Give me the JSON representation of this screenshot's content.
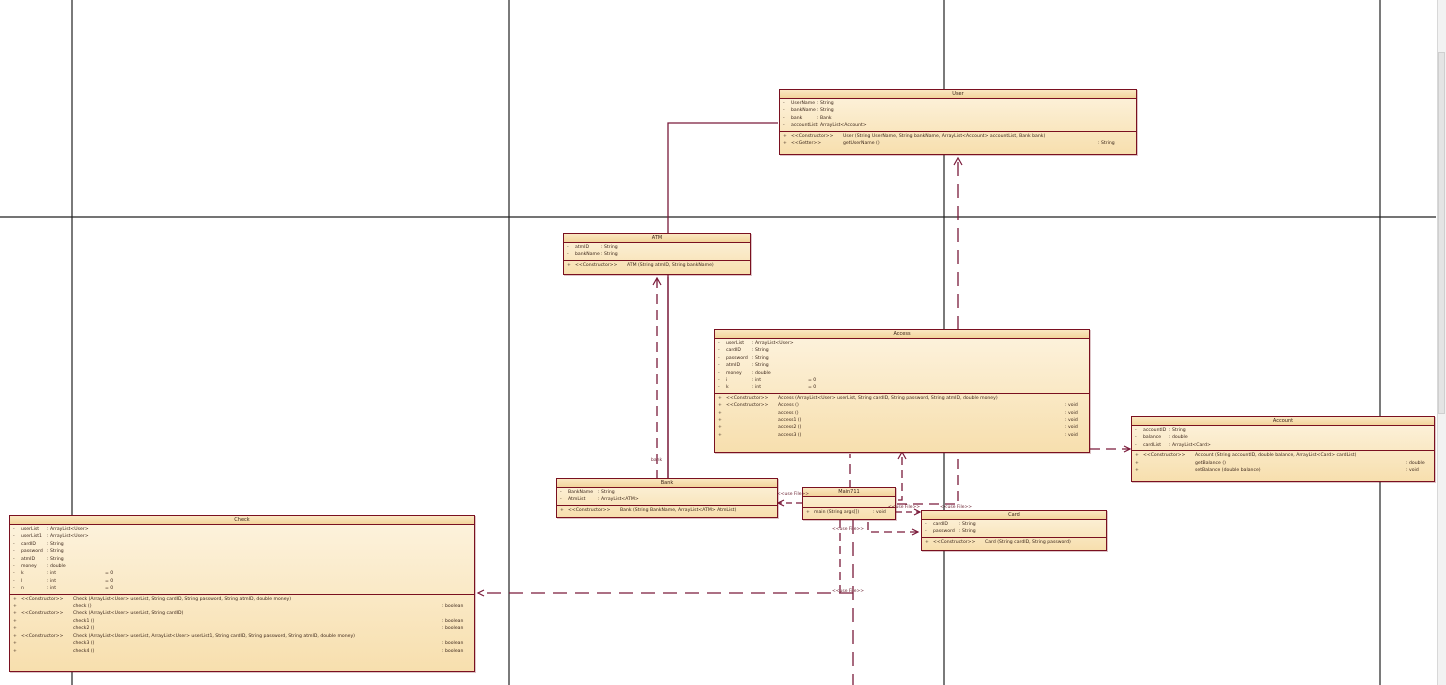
{
  "classes": {
    "user": {
      "name": "User",
      "attributes": [
        {
          "vis": "-",
          "name": "UserName",
          "type": ": String"
        },
        {
          "vis": "-",
          "name": "bankName",
          "type": ": String"
        },
        {
          "vis": "-",
          "name": "bank",
          "type": ": Bank"
        },
        {
          "vis": "-",
          "name": "accountList",
          "type": ": ArrayList<Account>"
        }
      ],
      "operations": [
        {
          "vis": "+",
          "stereo": "<<Constructor>>",
          "sig": "User (String UserName, String bankName, ArrayList<Account> accountList, Bank bank)",
          "ret": ""
        },
        {
          "vis": "+",
          "stereo": "<<Getter>>",
          "sig": "getUserName ()",
          "ret": ": String"
        }
      ]
    },
    "atm": {
      "name": "ATM",
      "attributes": [
        {
          "vis": "-",
          "name": "atmID",
          "type": ": String"
        },
        {
          "vis": "-",
          "name": "bankName",
          "type": ": String"
        }
      ],
      "operations": [
        {
          "vis": "+",
          "stereo": "<<Constructor>>",
          "sig": "ATM (String atmID, String bankName)",
          "ret": ""
        }
      ]
    },
    "access": {
      "name": "Access",
      "attributes": [
        {
          "vis": "-",
          "name": "userList",
          "type": ": ArrayList<User>"
        },
        {
          "vis": "-",
          "name": "cardID",
          "type": ": String"
        },
        {
          "vis": "-",
          "name": "password",
          "type": ": String"
        },
        {
          "vis": "-",
          "name": "atmID",
          "type": ": String"
        },
        {
          "vis": "-",
          "name": "money",
          "type": ": double"
        },
        {
          "vis": "-",
          "name": "i",
          "type": ": int",
          "init": "= 0"
        },
        {
          "vis": "-",
          "name": "k",
          "type": ": int",
          "init": "= 0"
        }
      ],
      "operations": [
        {
          "vis": "+",
          "stereo": "<<Constructor>>",
          "sig": "Access (ArrayList<User> userList, String cardID, String password, String atmID, double money)",
          "ret": ""
        },
        {
          "vis": "+",
          "stereo": "<<Constructor>>",
          "sig": "Access ()",
          "ret": ": void"
        },
        {
          "vis": "+",
          "stereo": "",
          "sig": "access ()",
          "ret": ": void"
        },
        {
          "vis": "+",
          "stereo": "",
          "sig": "access1 ()",
          "ret": ": void"
        },
        {
          "vis": "+",
          "stereo": "",
          "sig": "access2 ()",
          "ret": ": void"
        },
        {
          "vis": "+",
          "stereo": "",
          "sig": "access3 ()",
          "ret": ": void"
        }
      ]
    },
    "account": {
      "name": "Account",
      "attributes": [
        {
          "vis": "-",
          "name": "accountID",
          "type": ": String"
        },
        {
          "vis": "-",
          "name": "balance",
          "type": ": double"
        },
        {
          "vis": "-",
          "name": "cardList",
          "type": ": ArrayList<Card>"
        }
      ],
      "operations": [
        {
          "vis": "+",
          "stereo": "<<Constructor>>",
          "sig": "Account (String accountID, double balance, ArrayList<Card> cardList)",
          "ret": ""
        },
        {
          "vis": "+",
          "stereo": "",
          "sig": "getBalance ()",
          "ret": ": double"
        },
        {
          "vis": "+",
          "stereo": "",
          "sig": "setBalance (double balance)",
          "ret": ": void"
        }
      ]
    },
    "bank": {
      "name": "Bank",
      "attributes": [
        {
          "vis": "-",
          "name": "BankName",
          "type": ": String"
        },
        {
          "vis": "-",
          "name": "AtmList",
          "type": ": ArrayList<ATM>"
        }
      ],
      "operations": [
        {
          "vis": "+",
          "stereo": "<<Constructor>>",
          "sig": "Bank (String BankName, ArrayList<ATM> AtmList)",
          "ret": ""
        }
      ]
    },
    "main": {
      "name": "Main711",
      "attributes": [],
      "operations": [
        {
          "vis": "+",
          "stereo": "",
          "sig": "main (String args[])",
          "ret": ": void"
        }
      ]
    },
    "card": {
      "name": "Card",
      "attributes": [
        {
          "vis": "-",
          "name": "cardID",
          "type": ": String"
        },
        {
          "vis": "-",
          "name": "password",
          "type": ": String"
        }
      ],
      "operations": [
        {
          "vis": "+",
          "stereo": "<<Constructor>>",
          "sig": "Card (String cardID, String password)",
          "ret": ""
        }
      ]
    },
    "check": {
      "name": "Check",
      "attributes": [
        {
          "vis": "-",
          "name": "userList",
          "type": ": ArrayList<User>"
        },
        {
          "vis": "-",
          "name": "userList1",
          "type": ": ArrayList<User>"
        },
        {
          "vis": "-",
          "name": "cardID",
          "type": ": String"
        },
        {
          "vis": "-",
          "name": "password",
          "type": ": String"
        },
        {
          "vis": "-",
          "name": "atmID",
          "type": ": String"
        },
        {
          "vis": "-",
          "name": "money",
          "type": ": double"
        },
        {
          "vis": "-",
          "name": "k",
          "type": ": int",
          "init": "= 0"
        },
        {
          "vis": "-",
          "name": "l",
          "type": ": int",
          "init": "= 0"
        },
        {
          "vis": "-",
          "name": "n",
          "type": ": int",
          "init": "= 0"
        }
      ],
      "operations": [
        {
          "vis": "+",
          "stereo": "<<Constructor>>",
          "sig": "Check (ArrayList<User> userList, String cardID, String password, String atmID, double money)",
          "ret": ""
        },
        {
          "vis": "+",
          "stereo": "",
          "sig": "check ()",
          "ret": ": boolean"
        },
        {
          "vis": "+",
          "stereo": "<<Constructor>>",
          "sig": "Check (ArrayList<User> userList, String cardID)",
          "ret": ""
        },
        {
          "vis": "+",
          "stereo": "",
          "sig": "check1 ()",
          "ret": ": boolean"
        },
        {
          "vis": "+",
          "stereo": "",
          "sig": "check2 ()",
          "ret": ": boolean"
        },
        {
          "vis": "+",
          "stereo": "<<Constructor>>",
          "sig": "Check (ArrayList<User> userList, ArrayList<User> userList1, String cardID, String password, String atmID, double money)",
          "ret": ""
        },
        {
          "vis": "+",
          "stereo": "",
          "sig": "check3 ()",
          "ret": ": boolean"
        },
        {
          "vis": "+",
          "stereo": "",
          "sig": "check4 ()",
          "ret": ": boolean"
        }
      ]
    }
  },
  "labels": {
    "bank_role": "bank",
    "use1": "<<use File>>",
    "use2": "<<use File>>",
    "use3": "<<use File>>",
    "use4": "<<use File>>",
    "use5": "<<use File>>"
  },
  "colors": {
    "line": "#7a1a3a",
    "box_border": "#7a1020",
    "fill_top": "#fdf3de",
    "fill_bottom": "#f7dfae"
  }
}
